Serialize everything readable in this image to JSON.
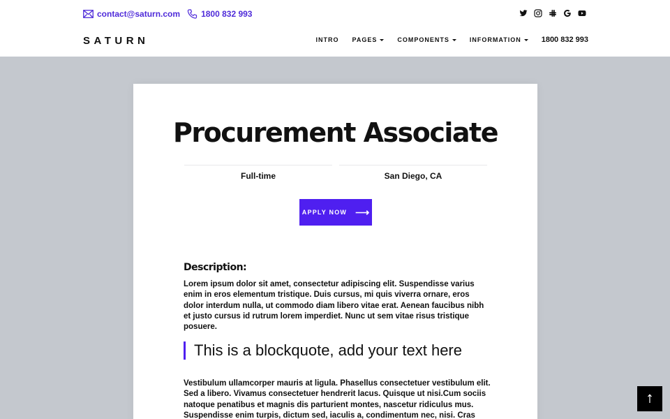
{
  "header": {
    "email": "contact@saturn.com",
    "phone": "1800 832 993",
    "brand": "SATURN",
    "social": [
      "twitter-icon",
      "instagram-icon",
      "slack-icon",
      "google-icon",
      "youtube-icon"
    ],
    "nav": [
      {
        "label": "INTRO",
        "dropdown": false
      },
      {
        "label": "PAGES",
        "dropdown": true
      },
      {
        "label": "COMPONENTS",
        "dropdown": true
      },
      {
        "label": "INFORMATION",
        "dropdown": true
      }
    ],
    "nav_phone": "1800 832 993"
  },
  "job": {
    "title": "Procurement Associate",
    "type": "Full-time",
    "location": "San Diego, CA",
    "apply_label": "APPLY NOW",
    "description_heading": "Description:",
    "description": "Lorem ipsum dolor sit amet, consectetur adipiscing elit. Suspendisse varius enim in eros elementum tristique. Duis cursus, mi quis viverra ornare, eros dolor interdum nulla, ut commodo diam libero vitae erat. Aenean faucibus nibh et justo cursus id rutrum lorem imperdiet. Nunc ut sem vitae risus tristique posuere.",
    "blockquote": "This is a blockquote, add your text here",
    "body": "Vestibulum ullamcorper mauris at ligula. Phasellus consectetuer vestibulum elit. Sed a libero. Vivamus consectetuer hendrerit lacus. Quisque ut nisi.Cum sociis natoque penatibus et magnis dis parturient montes, nascetur ridiculus mus. Suspendisse enim turpis, dictum sed, iaculis a, condimentum nec, nisi. Cras varius. Ut leo. Sed"
  },
  "colors": {
    "accent": "#4f1ff0",
    "page_bg": "#c4c8ce"
  }
}
